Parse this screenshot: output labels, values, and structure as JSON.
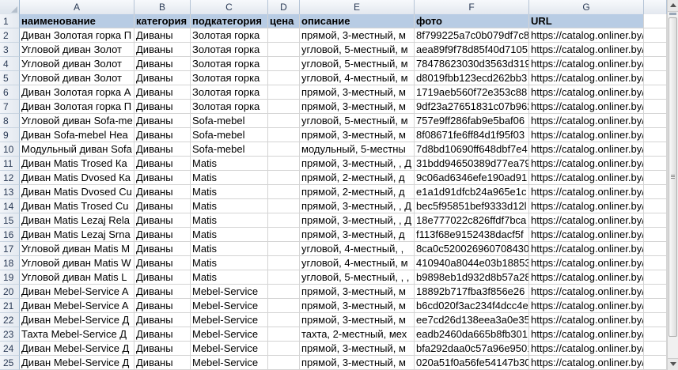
{
  "columns": [
    "A",
    "B",
    "C",
    "D",
    "E",
    "F",
    "G"
  ],
  "header": [
    "наименование",
    "категория",
    "подкатегория",
    "цена",
    "описание",
    "фото",
    "URL"
  ],
  "rows": [
    {
      "n": "2",
      "a": "Диван Золотая горка П",
      "b": "Диваны",
      "c": "Золотая горка",
      "d": "",
      "e": "прямой, 3-местный, м",
      "f": "8f799225a7c0b079df7c8",
      "g": "https://catalog.onliner.by/d"
    },
    {
      "n": "3",
      "a": "Угловой диван Золот",
      "b": "Диваны",
      "c": "Золотая горка",
      "d": "",
      "e": "угловой, 5-местный, м",
      "f": "aea89f9f78d85f40d7105",
      "g": "https://catalog.onliner.by/d"
    },
    {
      "n": "4",
      "a": "Угловой диван Золот",
      "b": "Диваны",
      "c": "Золотая горка",
      "d": "",
      "e": "угловой, 5-местный, м",
      "f": "78478623030d3563d319",
      "g": "https://catalog.onliner.by/d"
    },
    {
      "n": "5",
      "a": "Угловой диван Золот",
      "b": "Диваны",
      "c": "Золотая горка",
      "d": "",
      "e": "угловой, 4-местный, м",
      "f": "d8019fbb123ecd262bb3",
      "g": "https://catalog.onliner.by/d"
    },
    {
      "n": "6",
      "a": "Диван Золотая горка А",
      "b": "Диваны",
      "c": "Золотая горка",
      "d": "",
      "e": "прямой, 3-местный, м",
      "f": "1719aeb560f72e353c88",
      "g": "https://catalog.onliner.by/d"
    },
    {
      "n": "7",
      "a": "Диван Золотая горка П",
      "b": "Диваны",
      "c": "Золотая горка",
      "d": "",
      "e": "прямой, 3-местный, м",
      "f": "9df23a27651831c07b962",
      "g": "https://catalog.onliner.by/d"
    },
    {
      "n": "8",
      "a": "Угловой диван Sofa-me",
      "b": "Диваны",
      "c": "Sofa-mebel",
      "d": "",
      "e": "угловой, 5-местный, м",
      "f": "757e9ff286fab9e5baf06",
      "g": "https://catalog.onliner.by/d"
    },
    {
      "n": "9",
      "a": "Диван Sofa-mebel Hea",
      "b": "Диваны",
      "c": "Sofa-mebel",
      "d": "",
      "e": "прямой, 3-местный, м",
      "f": "8f08671fe6ff84d1f95f03",
      "g": "https://catalog.onliner.by/d"
    },
    {
      "n": "10",
      "a": "Модульный диван Sofa",
      "b": "Диваны",
      "c": "Sofa-mebel",
      "d": "",
      "e": "модульный, 5-местны",
      "f": "7d8bd10690ff648dbf7e4",
      "g": "https://catalog.onliner.by/d"
    },
    {
      "n": "11",
      "a": "Диван Matis Trosed Ка",
      "b": "Диваны",
      "c": "Matis",
      "d": "",
      "e": "прямой, 3-местный, , Д",
      "f": "31bdd94650389d77ea79",
      "g": "https://catalog.onliner.by/d"
    },
    {
      "n": "12",
      "a": "Диван Matis Dvosed Ка",
      "b": "Диваны",
      "c": "Matis",
      "d": "",
      "e": "прямой, 2-местный, д",
      "f": "9c06ad6346efe190ad91",
      "g": "https://catalog.onliner.by/d"
    },
    {
      "n": "13",
      "a": "Диван Matis Dvosed Cu",
      "b": "Диваны",
      "c": "Matis",
      "d": "",
      "e": "прямой, 2-местный, д",
      "f": "e1a1d91dfcb24a965e1c",
      "g": "https://catalog.onliner.by/d"
    },
    {
      "n": "14",
      "a": "Диван Matis Trosed Cu",
      "b": "Диваны",
      "c": "Matis",
      "d": "",
      "e": "прямой, 3-местный, , Д",
      "f": "bec5f95851bef9333d12l",
      "g": "https://catalog.onliner.by/d"
    },
    {
      "n": "15",
      "a": "Диван Matis Lezaj Rela",
      "b": "Диваны",
      "c": "Matis",
      "d": "",
      "e": "прямой, 3-местный, , Д",
      "f": "18e777022c826ffdf7bca",
      "g": "https://catalog.onliner.by/d"
    },
    {
      "n": "16",
      "a": "Диван Matis Lezaj Srna",
      "b": "Диваны",
      "c": "Matis",
      "d": "",
      "e": "прямой, 3-местный, д",
      "f": "f113f68e9152438dacf5f",
      "g": "https://catalog.onliner.by/d"
    },
    {
      "n": "17",
      "a": "Угловой диван Matis M",
      "b": "Диваны",
      "c": "Matis",
      "d": "",
      "e": "угловой, 4-местный, ,",
      "f": "8ca0c520026960708430c",
      "g": "https://catalog.onliner.by/d"
    },
    {
      "n": "18",
      "a": "Угловой диван Matis W",
      "b": "Диваны",
      "c": "Matis",
      "d": "",
      "e": "угловой, 4-местный, м",
      "f": "410940a8044e03b18853",
      "g": "https://catalog.onliner.by/d"
    },
    {
      "n": "19",
      "a": "Угловой диван Matis L",
      "b": "Диваны",
      "c": "Matis",
      "d": "",
      "e": "угловой, 5-местный, , ,",
      "f": "b9898eb1d932d8b57a28",
      "g": "https://catalog.onliner.by/d"
    },
    {
      "n": "20",
      "a": "Диван Mebel-Service A",
      "b": "Диваны",
      "c": "Mebel-Service",
      "d": "",
      "e": "прямой, 3-местный, м",
      "f": "18892b717fba3f856e26",
      "g": "https://catalog.onliner.by/d"
    },
    {
      "n": "21",
      "a": "Диван Mebel-Service A",
      "b": "Диваны",
      "c": "Mebel-Service",
      "d": "",
      "e": "прямой, 3-местный, м",
      "f": "b6cd020f3ac234f4dcc4e",
      "g": "https://catalog.onliner.by/d"
    },
    {
      "n": "22",
      "a": "Диван Mebel-Service Д",
      "b": "Диваны",
      "c": "Mebel-Service",
      "d": "",
      "e": "прямой, 3-местный, м",
      "f": "ee7cd26d138eea3a0e35",
      "g": "https://catalog.onliner.by/d"
    },
    {
      "n": "23",
      "a": "Тахта Mebel-Service Д",
      "b": "Диваны",
      "c": "Mebel-Service",
      "d": "",
      "e": "тахта, 2-местный, мех",
      "f": "eadb2460da665b8fb301",
      "g": "https://catalog.onliner.by/d"
    },
    {
      "n": "24",
      "a": "Диван Mebel-Service Д",
      "b": "Диваны",
      "c": "Mebel-Service",
      "d": "",
      "e": "прямой, 3-местный, м",
      "f": "bfa292daa0c57a96e9501",
      "g": "https://catalog.onliner.by/d"
    },
    {
      "n": "25",
      "a": "Диван Mebel-Service Д",
      "b": "Диваны",
      "c": "Mebel-Service",
      "d": "",
      "e": "прямой, 3-местный, м",
      "f": "020a51f0a56fe54147b30",
      "g": "https://catalog.onliner.by/d"
    }
  ]
}
